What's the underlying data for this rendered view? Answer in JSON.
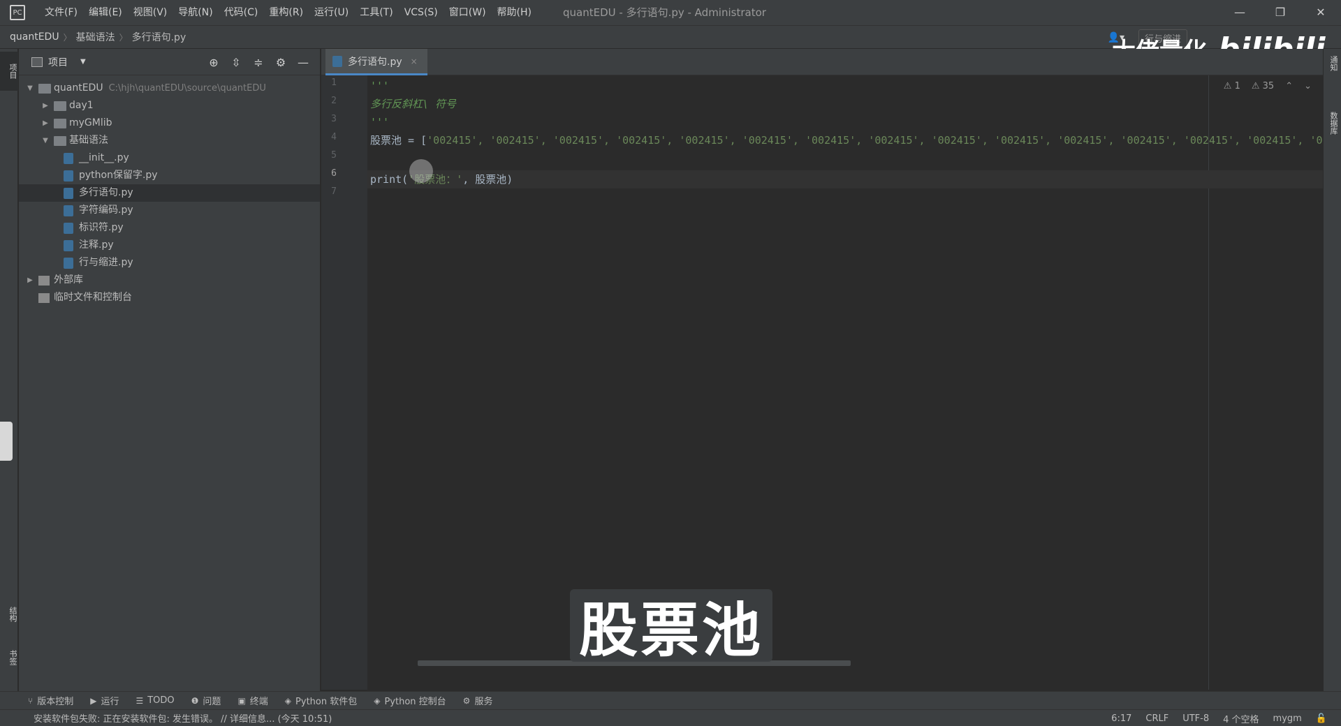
{
  "window": {
    "title": "quantEDU - 多行语句.py - Administrator",
    "menu": [
      "文件(F)",
      "编辑(E)",
      "视图(V)",
      "导航(N)",
      "代码(C)",
      "重构(R)",
      "运行(U)",
      "工具(T)",
      "VCS(S)",
      "窗口(W)",
      "帮助(H)"
    ],
    "controls": [
      "—",
      "❐",
      "✕"
    ]
  },
  "breadcrumb": {
    "project": "quantEDU",
    "folder": "基础语法",
    "file": "多行语句.py"
  },
  "navbar": {
    "run_config": "行与缩进"
  },
  "watermark": {
    "text": "大佬量化",
    "logo": "bilibili"
  },
  "project_panel": {
    "title": "项目",
    "tree": [
      {
        "label": "quantEDU",
        "path": "C:\\hjh\\quantEDU\\source\\quantEDU",
        "kind": "folder",
        "level": 0,
        "expanded": true
      },
      {
        "label": "day1",
        "kind": "folder",
        "level": 1,
        "expanded": false
      },
      {
        "label": "myGMlib",
        "kind": "folder",
        "level": 1,
        "expanded": false
      },
      {
        "label": "基础语法",
        "kind": "folder",
        "level": 1,
        "expanded": true
      },
      {
        "label": "__init__.py",
        "kind": "py",
        "level": 2
      },
      {
        "label": "python保留字.py",
        "kind": "py",
        "level": 2
      },
      {
        "label": "多行语句.py",
        "kind": "py",
        "level": 2,
        "selected": true
      },
      {
        "label": "字符编码.py",
        "kind": "py",
        "level": 2
      },
      {
        "label": "标识符.py",
        "kind": "py",
        "level": 2
      },
      {
        "label": "注释.py",
        "kind": "py",
        "level": 2
      },
      {
        "label": "行与缩进.py",
        "kind": "py",
        "level": 2
      },
      {
        "label": "外部库",
        "kind": "lib",
        "level": 0,
        "expanded": false
      },
      {
        "label": "临时文件和控制台",
        "kind": "lib",
        "level": 0
      }
    ]
  },
  "left_strip": {
    "project_tab": "项目",
    "structure_tab": "结构",
    "bookmarks_tab": "书签"
  },
  "right_strip": {
    "notifications_tab": "通知",
    "database_tab": "数据库"
  },
  "editor": {
    "tab_label": "多行语句.py",
    "tab_close": "×",
    "inspections": {
      "warnings": "⚠ 1",
      "weak_warnings": "⚠ 35"
    },
    "line_numbers": [
      "1",
      "2",
      "3",
      "4",
      "5",
      "6",
      "7"
    ],
    "current_line": 6,
    "lines": {
      "l1": "'''",
      "l2": "多行反斜杠\\ 符号",
      "l3": "'''",
      "l4_var": "股票池",
      "l4_op": " = [",
      "l4_items": "'002415', '002415', '002415', '002415', '002415', '002415', '002415', '002415', '002415', '002415', '002415', '002415', '002415', '002415', '00",
      "l6_func": "print(",
      "l6_str": "'股票池：'",
      "l6_rest": ", 股票池)"
    }
  },
  "subtitle": "股票池",
  "bottom_tools": [
    {
      "icon": "⑂",
      "label": "版本控制"
    },
    {
      "icon": "▶",
      "label": "运行"
    },
    {
      "icon": "☰",
      "label": "TODO"
    },
    {
      "icon": "❶",
      "label": "问题"
    },
    {
      "icon": "▣",
      "label": "终端"
    },
    {
      "icon": "◈",
      "label": "Python 软件包"
    },
    {
      "icon": "◈",
      "label": "Python 控制台"
    },
    {
      "icon": "⚙",
      "label": "服务"
    }
  ],
  "status": {
    "message": "安装软件包失败: 正在安装软件包: 发生错误。 // 详细信息... (今天 10:51)",
    "position": "6:17",
    "line_sep": "CRLF",
    "encoding": "UTF-8",
    "indent": "4 个空格",
    "interpreter": "mygm"
  }
}
